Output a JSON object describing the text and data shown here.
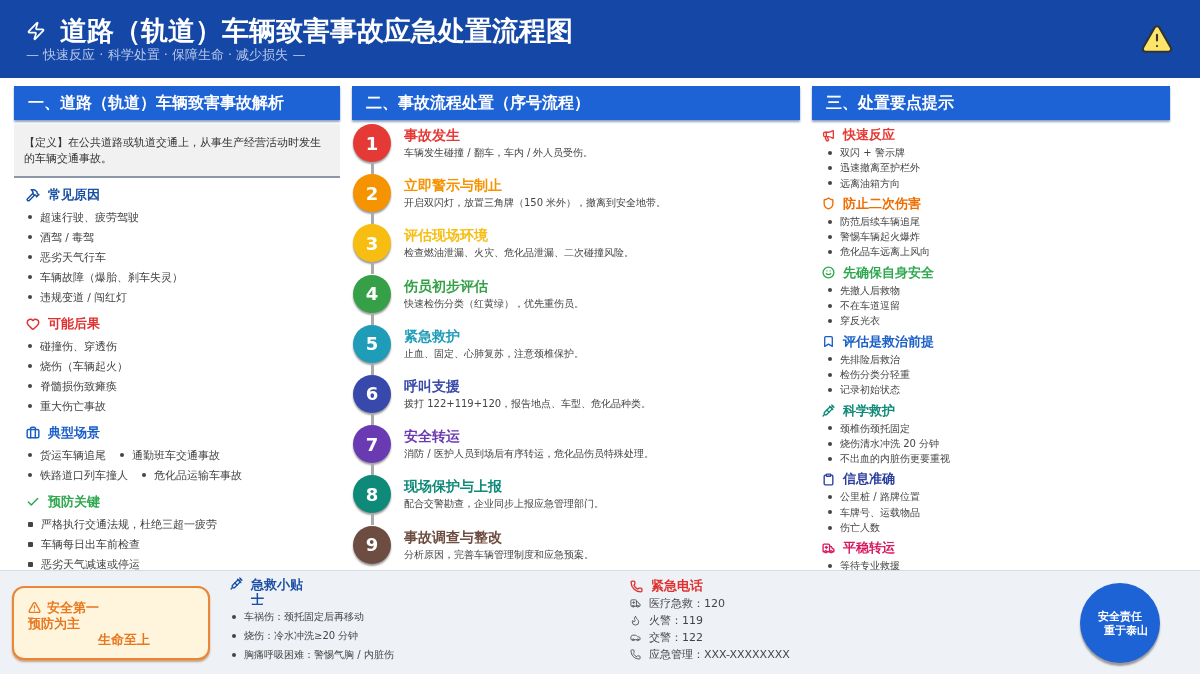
{
  "header": {
    "title": "道路（轨道）车辆致害事故应急处置流程图",
    "subtitle": "—  快速反应  ·  科学处置  ·  保障生命  ·  减少损失  —"
  },
  "left": {
    "heading": "一、道路（轨道）车辆致害事故解析",
    "definition": "【定义】在公共道路或轨道交通上，从事生产经营活动时发生的车辆交通事故。",
    "groups": [
      {
        "title": "常见原因",
        "color": "#1a4fa3",
        "kind": "bullet",
        "items": [
          "超速行驶、疲劳驾驶",
          "酒驾 / 毒驾",
          "恶劣天气行车",
          "车辆故障（爆胎、刹车失灵）",
          "违规变道 / 闯红灯"
        ]
      },
      {
        "title": "可能后果",
        "color": "#e03030",
        "kind": "bullet",
        "items": [
          "碰撞伤、穿透伤",
          "烧伤（车辆起火）",
          "脊髓损伤致瘫痪",
          "重大伤亡事故"
        ]
      },
      {
        "title": "典型场景",
        "color": "#1a5fc8",
        "kind": "inline",
        "items": [
          "货运车辆追尾",
          "通勤班车交通事故",
          "铁路道口列车撞人",
          "危化品运输车事故"
        ]
      },
      {
        "title": "预防关键",
        "color": "#2fa84f",
        "kind": "square",
        "items": [
          "严格执行交通法规，杜绝三超一疲劳",
          "车辆每日出车前检查",
          "恶劣天气减速或停运"
        ]
      }
    ]
  },
  "middle": {
    "heading": "二、事故流程处置（序号流程）",
    "steps": [
      {
        "number": "1",
        "title": "事故发生",
        "text": "车辆发生碰撞 / 翻车，车内 / 外人员受伤。",
        "color": "#e53935"
      },
      {
        "number": "2",
        "title": "立即警示与制止",
        "text": "开启双闪灯，放置三角牌（150 米外），撤离到安全地带。",
        "color": "#f59300"
      },
      {
        "number": "3",
        "title": "评估现场环境",
        "text": "检查燃油泄漏、火灾、危化品泄漏、二次碰撞风险。",
        "color": "#f7bd10"
      },
      {
        "number": "4",
        "title": "伤员初步评估",
        "text": "快速检伤分类（红黄绿），优先重伤员。",
        "color": "#36a048"
      },
      {
        "number": "5",
        "title": "紧急救护",
        "text": "止血、固定、心肺复苏，注意颈椎保护。",
        "color": "#1e9cb8"
      },
      {
        "number": "6",
        "title": "呼叫支援",
        "text": "拨打 122+119+120，报告地点、车型、危化品种类。",
        "color": "#3949ab"
      },
      {
        "number": "7",
        "title": "安全转运",
        "text": "消防 / 医护人员到场后有序转运，危化品伤员特殊处理。",
        "color": "#6a3ab2"
      },
      {
        "number": "8",
        "title": "现场保护与上报",
        "text": "配合交警勘查，企业同步上报应急管理部门。",
        "color": "#0f8a78"
      },
      {
        "number": "9",
        "title": "事故调查与整改",
        "text": "分析原因，完善车辆管理制度和应急预案。",
        "color": "#6d4c41"
      }
    ]
  },
  "right": {
    "heading": "三、处置要点提示",
    "groups": [
      {
        "title": "快速反应",
        "color": "#e53935",
        "items": [
          "双闪 + 警示牌",
          "迅速撤离至护栏外",
          "远离油箱方向"
        ]
      },
      {
        "title": "防止二次伤害",
        "color": "#ef6c00",
        "items": [
          "防范后续车辆追尾",
          "警惕车辆起火爆炸",
          "危化品车远离上风向"
        ]
      },
      {
        "title": "先确保自身安全",
        "color": "#2fa84f",
        "items": [
          "先撤人后救物",
          "不在车道逗留",
          "穿反光衣"
        ]
      },
      {
        "title": "评估是救治前提",
        "color": "#1a5fc8",
        "items": [
          "先排险后救治",
          "检伤分类分轻重",
          "记录初始状态"
        ]
      },
      {
        "title": "科学救护",
        "color": "#0f8a78",
        "items": [
          "颈椎伤颈托固定",
          "烧伤清水冲洗 20 分钟",
          "不出血的内脏伤更要重视"
        ]
      },
      {
        "title": "信息准确",
        "color": "#2c3f9e",
        "items": [
          "公里桩 / 路牌位置",
          "车牌号、运载物品",
          "伤亡人数"
        ]
      },
      {
        "title": "平稳转运",
        "color": "#d81b60",
        "items": [
          "等待专业救援"
        ]
      }
    ]
  },
  "footer": {
    "safety": [
      "安全第一",
      "预防为主",
      "生命至上"
    ],
    "tips": {
      "title": "急救小贴士",
      "items": [
        "车祸伤：颈托固定后再移动",
        "烧伤：冷水冲洗≥20 分钟",
        "胸痛呼吸困难：警惕气胸 / 内脏伤"
      ]
    },
    "hotline": {
      "title": "紧急电话",
      "items": [
        "医疗急救：120",
        "火警：119",
        "交警：122",
        "应急管理：XXX-XXXXXXXX"
      ]
    },
    "badge": [
      "安全责任",
      "重于泰山"
    ]
  }
}
